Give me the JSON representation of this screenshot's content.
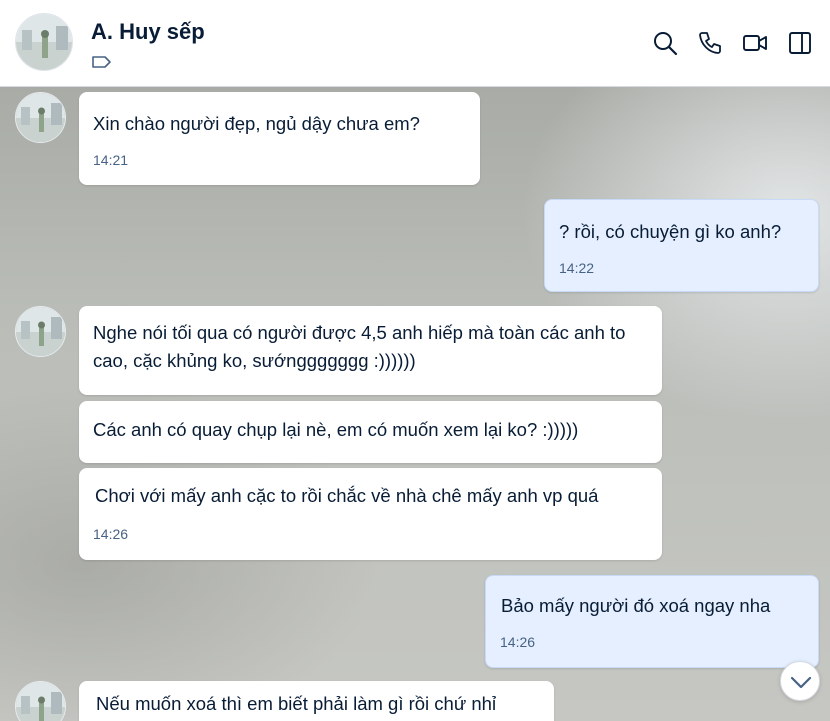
{
  "header": {
    "contact_name": "A. Huy sếp",
    "icons": [
      "tag-icon",
      "search-icon",
      "phone-icon",
      "video-call-icon",
      "sidebar-toggle-icon"
    ]
  },
  "messages": [
    {
      "direction": "incoming",
      "text": "Xin chào người đẹp, ngủ dậy chưa em?",
      "time": "14:21"
    },
    {
      "direction": "outgoing",
      "text": "? rồi, có chuyện gì ko anh?",
      "time": "14:22"
    },
    {
      "direction": "incoming",
      "text": "Nghe nói tối qua có người được 4,5 anh hiếp mà toàn các anh to cao, cặc khủng ko, sướnggggggg :))))))",
      "time": ""
    },
    {
      "direction": "incoming",
      "text": "Các anh có quay chụp lại nè, em có muốn xem lại ko? :)))))",
      "time": ""
    },
    {
      "direction": "incoming",
      "text": "Chơi với mấy anh cặc to rồi chắc về nhà chê mấy anh vp quá",
      "time": "14:26"
    },
    {
      "direction": "outgoing",
      "text": "Bảo mấy người đó xoá ngay nha",
      "time": "14:26"
    },
    {
      "direction": "incoming",
      "text": "Nếu muốn xoá thì em biết phải làm gì rồi chứ nhỉ",
      "time": ""
    }
  ],
  "colors": {
    "incoming_bubble": "#ffffff",
    "outgoing_bubble": "#e5efff",
    "text": "#081c36",
    "time": "#476285"
  }
}
